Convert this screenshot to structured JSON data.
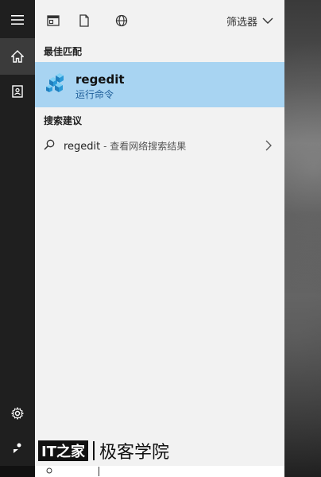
{
  "header": {
    "filter_label": "筛选器"
  },
  "sections": {
    "best_match_label": "最佳匹配",
    "suggestions_label": "搜索建议"
  },
  "best_match": {
    "title": "regedit",
    "subtitle": "运行命令"
  },
  "suggestion": {
    "query": "regedit",
    "suffix": " - 查看网络搜索结果"
  },
  "watermark": {
    "logo": "IT之家",
    "text": "极客学院"
  },
  "colors": {
    "rail_bg": "#1f1f1f",
    "rail_active": "#3b3b3b",
    "panel_bg": "#f2f2f2",
    "best_match_bg": "#a8d4f2",
    "subtitle": "#1f5f9a"
  },
  "icons": {
    "rail": [
      "hamburger-icon",
      "home-icon",
      "notebook-icon",
      "settings-icon",
      "feedback-icon"
    ],
    "header": [
      "apps-icon",
      "document-icon",
      "web-icon",
      "chevron-down-icon"
    ],
    "best_match_app": "regedit-cubes-icon",
    "suggestion": "search-icon",
    "suggestion_chevron": "chevron-right-icon"
  }
}
